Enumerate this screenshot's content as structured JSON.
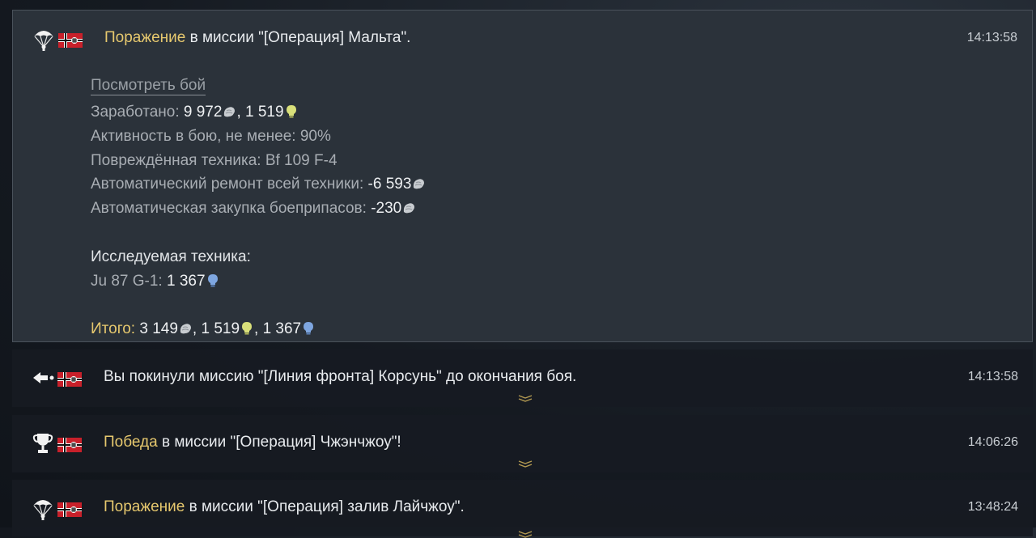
{
  "entries": [
    {
      "result": "Поражение",
      "text": " в миссии \"[Операция] Мальта\".",
      "time": "14:13:58",
      "icon": "parachute-icon",
      "details": {
        "view_battle": "Посмотреть бой",
        "earned_label": "Заработано: ",
        "earned_silver": "9 972",
        "earned_sep": ", ",
        "earned_rp": "1 519",
        "activity": "Активность в бою, не менее: 90%",
        "damaged": "Повреждённая техника: Bf 109 F-4",
        "repair_label": "Автоматический ремонт всей техники: ",
        "repair_value": "-6 593",
        "ammo_label": "Автоматическая закупка боеприпасов: ",
        "ammo_value": "-230",
        "research_title": "Исследуемая техника:",
        "research_vehicle": "Ju 87 G-1: ",
        "research_value": "1 367",
        "total_label": "Итого: ",
        "total_silver": "3 149",
        "total_sep1": ", ",
        "total_rp": "1 519",
        "total_sep2": ", ",
        "total_crp": "1 367"
      }
    },
    {
      "result": "",
      "text": "Вы покинули миссию \"[Линия фронта] Корсунь\" до окончания боя.",
      "time": "14:13:58",
      "icon": "leave-arrow-icon"
    },
    {
      "result": "Победа",
      "text": " в миссии \"[Операция] Чжэнчжоу\"!",
      "time": "14:06:26",
      "icon": "trophy-icon"
    },
    {
      "result": "Поражение",
      "text": " в миссии \"[Операция] залив Лайчжоу\".",
      "time": "13:48:24",
      "icon": "parachute-icon"
    }
  ],
  "colors": {
    "accent_gold": "#e6c86e",
    "silver_lions": "#c8ccd0",
    "research_points": "#d9e07a",
    "convertible_rp": "#7ea6e0"
  }
}
